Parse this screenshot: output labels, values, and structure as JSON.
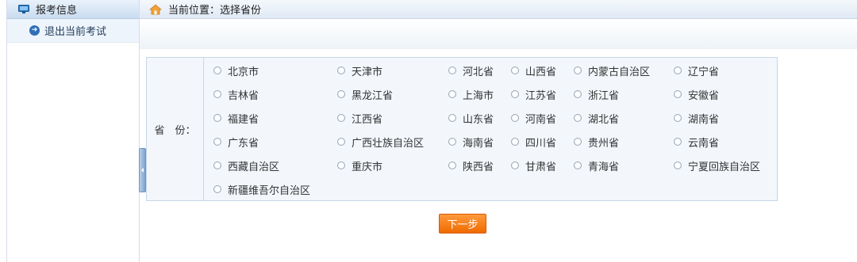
{
  "sidebar": {
    "header_label": "报考信息",
    "items": [
      {
        "label": "退出当前考试"
      }
    ]
  },
  "breadcrumb": {
    "text": "当前位置：选择省份"
  },
  "form": {
    "field_label": "省　份：",
    "provinces": [
      [
        "北京市",
        "天津市",
        "河北省",
        "山西省",
        "内蒙古自治区",
        "辽宁省"
      ],
      [
        "吉林省",
        "黑龙江省",
        "上海市",
        "江苏省",
        "浙江省",
        "安徽省"
      ],
      [
        "福建省",
        "江西省",
        "山东省",
        "河南省",
        "湖北省",
        "湖南省"
      ],
      [
        "广东省",
        "广西壮族自治区",
        "海南省",
        "四川省",
        "贵州省",
        "云南省"
      ],
      [
        "西藏自治区",
        "重庆市",
        "陕西省",
        "甘肃省",
        "青海省",
        "宁夏回族自治区"
      ],
      [
        "新疆维吾尔自治区"
      ]
    ],
    "next_label": "下一步"
  },
  "colors": {
    "accent": "#f07a10",
    "nav": "#2f6fb6",
    "panel_bg": "#f3f7fc"
  }
}
